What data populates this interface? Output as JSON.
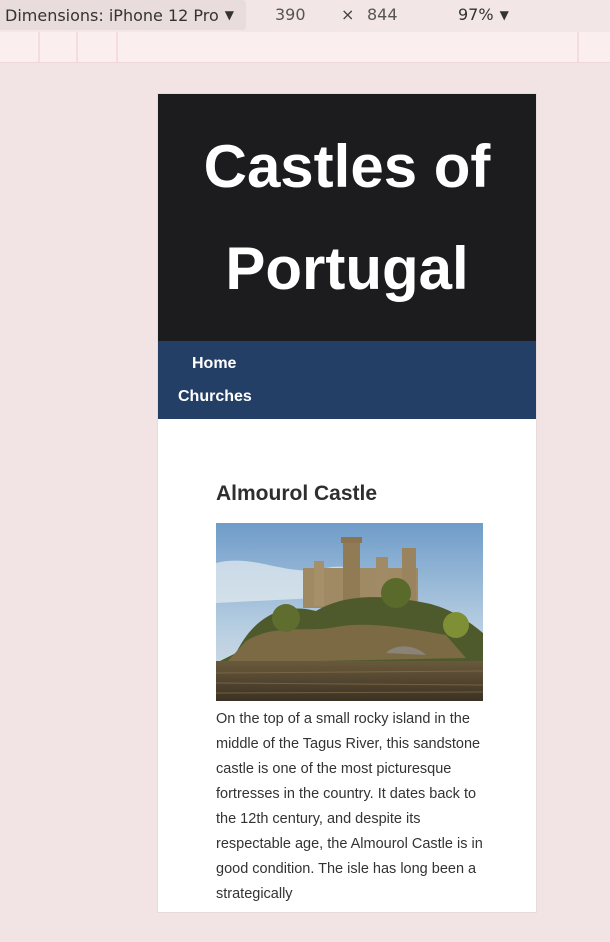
{
  "toolbar": {
    "dimensions_label": "Dimensions: iPhone 12 Pro",
    "width": "390",
    "times": "×",
    "height": "844",
    "zoom": "97%"
  },
  "site": {
    "title": "Castles of Portugal",
    "nav": [
      "Home",
      "Churches"
    ]
  },
  "article": {
    "heading": "Almourol Castle",
    "image_icon": "castle-photo",
    "body": "On the top of a small rocky island in the middle of the Tagus River, this sandstone castle is one of the most picturesque fortresses in the country. It dates back to the 12th century, and despite its respectable age, the Almourol Castle is in good condition. The isle has long been a strategically"
  }
}
